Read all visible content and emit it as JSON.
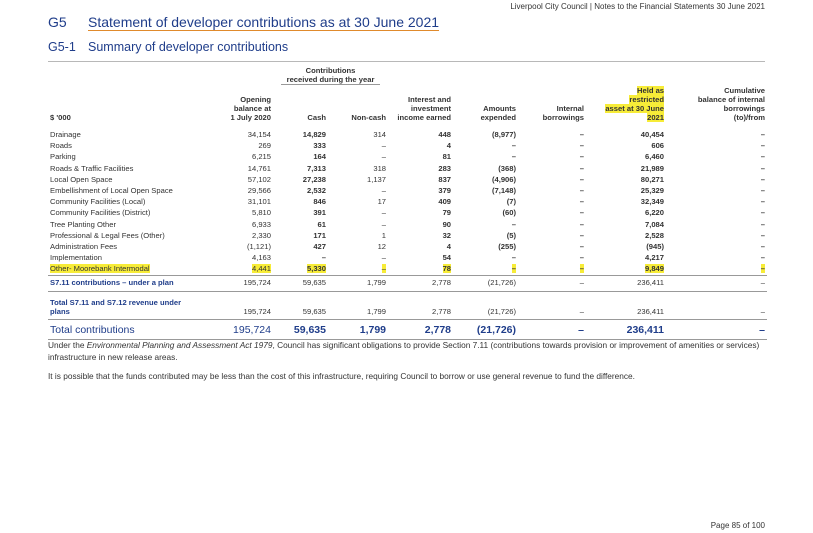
{
  "header_text": "Liverpool City Council | Notes to the Financial Statements 30 June 2021",
  "section": {
    "number": "G5",
    "title": "Statement of developer contributions as at 30 June 2021"
  },
  "subsection": {
    "number": "G5-1",
    "title": "Summary of developer contributions"
  },
  "table": {
    "group_header": {
      "line1": "Contributions",
      "line2": "received during the year"
    },
    "columns": {
      "label": "$ '000",
      "opening": [
        "Opening",
        "balance at",
        "1 July 2020"
      ],
      "cash": "Cash",
      "noncash": "Non-cash",
      "interest": [
        "Interest and",
        "investment",
        "income earned"
      ],
      "expended": [
        "Amounts",
        "expended"
      ],
      "internal": [
        "Internal",
        "borrowings"
      ],
      "held": [
        "Held as",
        "restricted",
        "asset at 30 June",
        "2021"
      ],
      "cumulative": [
        "Cumulative",
        "balance of internal",
        "borrowings",
        "(to)/from"
      ]
    },
    "rows": [
      {
        "label": "Drainage",
        "opening": "34,154",
        "cash": "14,829",
        "noncash": "314",
        "interest": "448",
        "expended": "(8,977)",
        "internal": "–",
        "held": "40,454",
        "cumulative": "–"
      },
      {
        "label": "Roads",
        "opening": "269",
        "cash": "333",
        "noncash": "–",
        "interest": "4",
        "expended": "–",
        "internal": "–",
        "held": "606",
        "cumulative": "–"
      },
      {
        "label": "Parking",
        "opening": "6,215",
        "cash": "164",
        "noncash": "–",
        "interest": "81",
        "expended": "–",
        "internal": "–",
        "held": "6,460",
        "cumulative": "–"
      },
      {
        "label": "Roads & Traffic Facilities",
        "opening": "14,761",
        "cash": "7,313",
        "noncash": "318",
        "interest": "283",
        "expended": "(368)",
        "internal": "–",
        "held": "21,989",
        "cumulative": "–"
      },
      {
        "label": "Local Open Space",
        "opening": "57,102",
        "cash": "27,238",
        "noncash": "1,137",
        "interest": "837",
        "expended": "(4,906)",
        "internal": "–",
        "held": "80,271",
        "cumulative": "–"
      },
      {
        "label": "Embellishment of Local Open Space",
        "opening": "29,566",
        "cash": "2,532",
        "noncash": "–",
        "interest": "379",
        "expended": "(7,148)",
        "internal": "–",
        "held": "25,329",
        "cumulative": "–"
      },
      {
        "label": "Community Facilities (Local)",
        "opening": "31,101",
        "cash": "846",
        "noncash": "17",
        "interest": "409",
        "expended": "(7)",
        "internal": "–",
        "held": "32,349",
        "cumulative": "–"
      },
      {
        "label": "Community Facilities (District)",
        "opening": "5,810",
        "cash": "391",
        "noncash": "–",
        "interest": "79",
        "expended": "(60)",
        "internal": "–",
        "held": "6,220",
        "cumulative": "–"
      },
      {
        "label": "Tree Planting Other",
        "opening": "6,933",
        "cash": "61",
        "noncash": "–",
        "interest": "90",
        "expended": "–",
        "internal": "–",
        "held": "7,084",
        "cumulative": "–"
      },
      {
        "label": "Professional & Legal Fees (Other)",
        "opening": "2,330",
        "cash": "171",
        "noncash": "1",
        "interest": "32",
        "expended": "(5)",
        "internal": "–",
        "held": "2,528",
        "cumulative": "–"
      },
      {
        "label": "Administration Fees",
        "opening": "(1,121)",
        "cash": "427",
        "noncash": "12",
        "interest": "4",
        "expended": "(255)",
        "internal": "–",
        "held": "(945)",
        "cumulative": "–"
      },
      {
        "label": "Implementation",
        "opening": "4,163",
        "cash": "–",
        "noncash": "–",
        "interest": "54",
        "expended": "–",
        "internal": "–",
        "held": "4,217",
        "cumulative": "–"
      },
      {
        "label": "Other- Moorebank Intermodal",
        "opening": "4,441",
        "cash": "5,330",
        "noncash": "–",
        "interest": "78",
        "expended": "–",
        "internal": "–",
        "held": "9,849",
        "cumulative": "–"
      }
    ],
    "plan_total": {
      "label": "S7.11 contributions – under a plan",
      "opening": "195,724",
      "cash": "59,635",
      "noncash": "1,799",
      "interest": "2,778",
      "expended": "(21,726)",
      "internal": "–",
      "held": "236,411",
      "cumulative": "–"
    },
    "revenue_total": {
      "label_line1": "Total S7.11 and S7.12 revenue under",
      "label_line2": "plans",
      "opening": "195,724",
      "cash": "59,635",
      "noncash": "1,799",
      "interest": "2,778",
      "expended": "(21,726)",
      "internal": "–",
      "held": "236,411",
      "cumulative": "–"
    },
    "grand_total": {
      "label": "Total contributions",
      "opening": "195,724",
      "cash": "59,635",
      "noncash": "1,799",
      "interest": "2,778",
      "expended": "(21,726)",
      "internal": "–",
      "held": "236,411",
      "cumulative": "–"
    }
  },
  "paragraph1": {
    "pre": "Under the ",
    "italic": "Environmental Planning and Assessment Act 1979",
    "post": ", Council has significant obligations to provide Section 7.11 (contributions towards provision or improvement of amenities or services) infrastructure in new release areas."
  },
  "paragraph2": "It is possible that the funds contributed may be less than the cost of this infrastructure, requiring Council to borrow or use general revenue to fund the difference.",
  "footer_text": "Page 85 of 100",
  "colors": {
    "heading": "#1f3d8a",
    "underline": "#e08a2c",
    "highlight": "#f7ec38"
  }
}
